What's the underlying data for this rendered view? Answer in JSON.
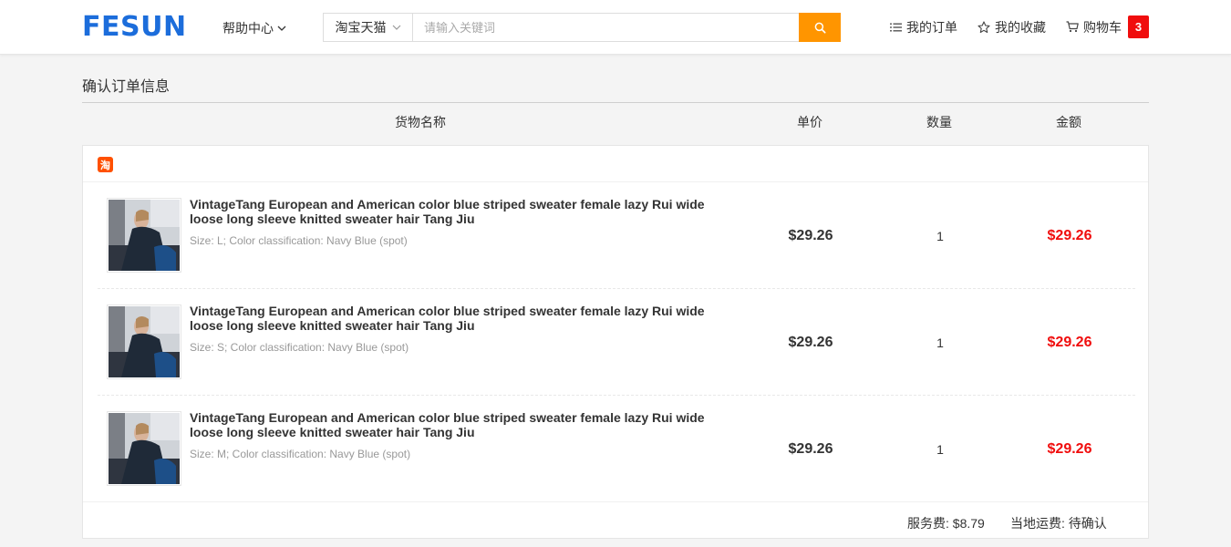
{
  "header": {
    "logo": "FESUN",
    "help_label": "帮助中心",
    "search": {
      "scope": "淘宝天猫",
      "placeholder": "请输入关键词",
      "value": ""
    },
    "links": {
      "orders": "我的订单",
      "favorites": "我的收藏",
      "cart": "购物车",
      "cart_count": "3"
    }
  },
  "page": {
    "title": "确认订单信息",
    "columns": {
      "name": "货物名称",
      "unit_price": "单价",
      "quantity": "数量",
      "amount": "金额"
    }
  },
  "order": {
    "shop_icon": "淘",
    "items": [
      {
        "name": "VintageTang European and American color blue striped sweater female lazy Rui wide loose long sleeve knitted sweater hair Tang Jiu",
        "spec": "Size: L; Color classification: Navy Blue (spot)",
        "price": "$29.26",
        "qty": "1",
        "total": "$29.26"
      },
      {
        "name": "VintageTang European and American color blue striped sweater female lazy Rui wide loose long sleeve knitted sweater hair Tang Jiu",
        "spec": "Size: S; Color classification: Navy Blue (spot)",
        "price": "$29.26",
        "qty": "1",
        "total": "$29.26"
      },
      {
        "name": "VintageTang European and American color blue striped sweater female lazy Rui wide loose long sleeve knitted sweater hair Tang Jiu",
        "spec": "Size: M; Color classification: Navy Blue (spot)",
        "price": "$29.26",
        "qty": "1",
        "total": "$29.26"
      }
    ],
    "service_fee": "服务费: $8.79",
    "shipping_fee": "当地运费: 待确认"
  },
  "colors": {
    "brand": "#1c6ddb",
    "search_button": "#ff9500",
    "price_red": "#f00d0d",
    "taobao_orange": "#ff5000"
  },
  "icons": {
    "help_dropdown": "chevron-down-icon",
    "scope_dropdown": "chevron-down-icon",
    "search": "search-icon",
    "orders": "list-icon",
    "favorites": "star-icon",
    "cart": "cart-icon"
  }
}
